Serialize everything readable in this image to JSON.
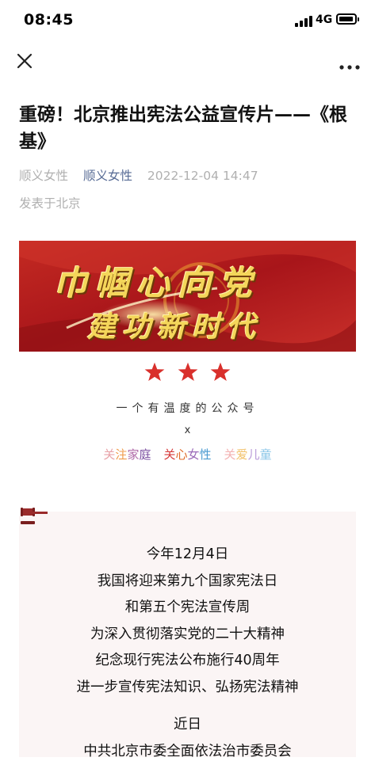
{
  "status_bar": {
    "time": "08:45",
    "network": "4G"
  },
  "nav": {
    "close_icon": "close-icon",
    "more_icon": "more-icon"
  },
  "article": {
    "title": "重磅！北京推出宪法公益宣传片——《根基》",
    "author": "顺义女性",
    "account": "顺义女性",
    "datetime": "2022-12-04 14:47",
    "location": "发表于北京"
  },
  "banner": {
    "line1": "巾帼心向党",
    "line2": "建功新时代"
  },
  "intro": {
    "tagline": "一个有温度的公众号",
    "x_mark": "x",
    "slogans": [
      {
        "chars": [
          {
            "c": "关",
            "color": "#e8a3a8"
          },
          {
            "c": "注",
            "color": "#f09a4a"
          },
          {
            "c": "家",
            "color": "#b06aa8"
          },
          {
            "c": "庭",
            "color": "#7a4ea0"
          }
        ]
      },
      {
        "chars": [
          {
            "c": "关",
            "color": "#d63a3a"
          },
          {
            "c": "心",
            "color": "#e06a2a"
          },
          {
            "c": "女",
            "color": "#9a6ab8"
          },
          {
            "c": "性",
            "color": "#4a9ad0"
          }
        ]
      },
      {
        "chars": [
          {
            "c": "关",
            "color": "#f3b2b2"
          },
          {
            "c": "爱",
            "color": "#f2c26b"
          },
          {
            "c": "儿",
            "color": "#b89ad8"
          },
          {
            "c": "童",
            "color": "#8ac6e8"
          }
        ]
      }
    ]
  },
  "content": {
    "lines": [
      "今年12月4日",
      "我国将迎来第九个国家宪法日",
      "和第五个宪法宣传周",
      "为深入贯彻落实党的二十大精神",
      "纪念现行宪法公布施行40周年",
      "进一步宣传宪法知识、弘扬宪法精神",
      "",
      "近日",
      "中共北京市委全面依法治市委员会"
    ]
  },
  "colors": {
    "accent_link": "#576b95",
    "meta_gray": "#b0b0b0",
    "banner_red": "#b81f1f",
    "star_red": "#d9302c",
    "card_bg": "#fbf5f5"
  }
}
